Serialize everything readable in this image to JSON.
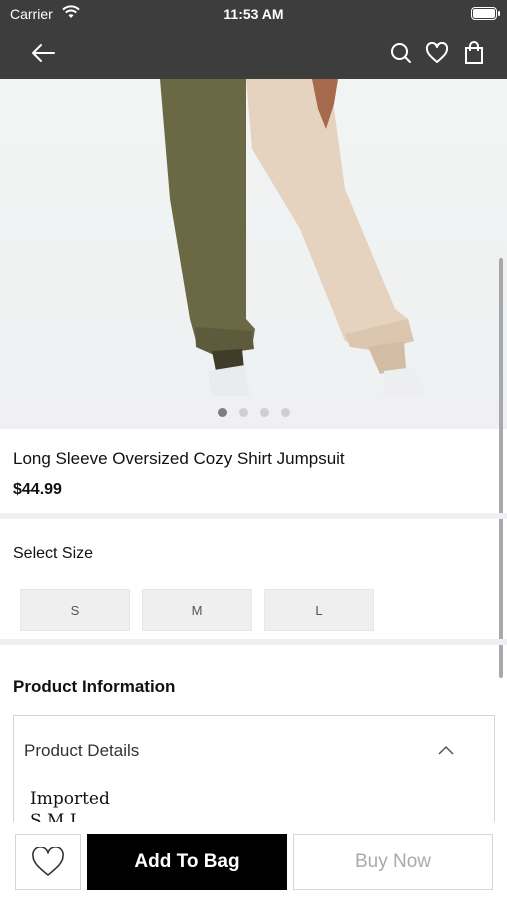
{
  "status_bar": {
    "carrier": "Carrier",
    "time": "11:53 AM"
  },
  "nav": {
    "back_icon": "arrow-left-icon",
    "search_icon": "search-icon",
    "wishlist_icon": "heart-icon",
    "bag_icon": "shopping-bag-icon"
  },
  "gallery": {
    "slide_count": 4,
    "active_index": 0
  },
  "product": {
    "title": "Long Sleeve Oversized Cozy Shirt Jumpsuit",
    "price": "$44.99"
  },
  "size_selector": {
    "label": "Select Size",
    "options": [
      "S",
      "M",
      "L"
    ]
  },
  "product_information": {
    "heading": "Product Information",
    "details_title": "Product Details",
    "details_lines": [
      "Imported",
      "S M L"
    ]
  },
  "bottom_bar": {
    "add_to_bag": "Add To Bag",
    "buy_now": "Buy Now"
  },
  "colors": {
    "nav_bg": "#3d3d3d",
    "accent": "#000000",
    "muted_text": "#aaaaaa"
  }
}
